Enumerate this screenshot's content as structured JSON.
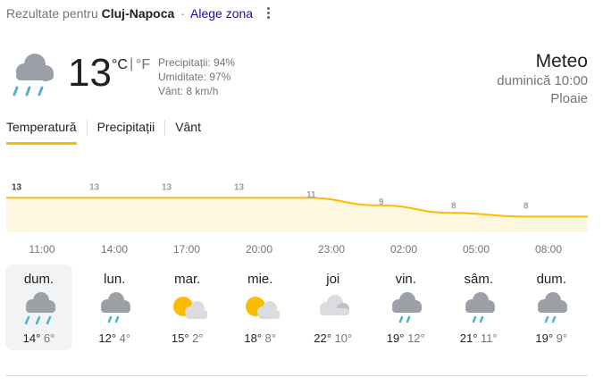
{
  "header": {
    "results_prefix": "Rezultate pentru",
    "city": "Cluj-Napoca",
    "separator": "·",
    "change_zone": "Alege zona"
  },
  "current": {
    "icon": "rain-cloud-icon",
    "temperature": "13",
    "unit_c": "°C",
    "unit_sep": "|",
    "unit_f": "°F",
    "precipitation": "Precipitații: 94%",
    "humidity": "Umiditate: 97%",
    "wind": "Vânt: 8 km/h"
  },
  "summary": {
    "title": "Meteo",
    "datetime": "duminică 10:00",
    "condition": "Ploaie"
  },
  "tabs": [
    {
      "label": "Temperatură",
      "active": true
    },
    {
      "label": "Precipitații",
      "active": false
    },
    {
      "label": "Vânt",
      "active": false
    }
  ],
  "chart_data": {
    "type": "area",
    "x": [
      "11:00",
      "14:00",
      "17:00",
      "20:00",
      "23:00",
      "02:00",
      "05:00",
      "08:00"
    ],
    "values": [
      13,
      13,
      13,
      13,
      11,
      9,
      8,
      8
    ],
    "color": "#fbbc04",
    "fill": "#fef7e0"
  },
  "forecast": [
    {
      "day": "dum.",
      "hi": "14°",
      "lo": "6°",
      "icon": "rain-cloud-icon",
      "selected": true
    },
    {
      "day": "lun.",
      "hi": "12°",
      "lo": "4°",
      "icon": "showers-icon",
      "selected": false
    },
    {
      "day": "mar.",
      "hi": "15°",
      "lo": "2°",
      "icon": "partly-cloudy-icon",
      "selected": false
    },
    {
      "day": "mie.",
      "hi": "18°",
      "lo": "8°",
      "icon": "partly-cloudy-icon",
      "selected": false
    },
    {
      "day": "joi",
      "hi": "22°",
      "lo": "10°",
      "icon": "cloudy-icon",
      "selected": false
    },
    {
      "day": "vin.",
      "hi": "19°",
      "lo": "12°",
      "icon": "showers-icon",
      "selected": false
    },
    {
      "day": "sâm.",
      "hi": "21°",
      "lo": "11°",
      "icon": "showers-icon",
      "selected": false
    },
    {
      "day": "dum.",
      "hi": "19°",
      "lo": "9°",
      "icon": "showers-icon",
      "selected": false
    }
  ]
}
